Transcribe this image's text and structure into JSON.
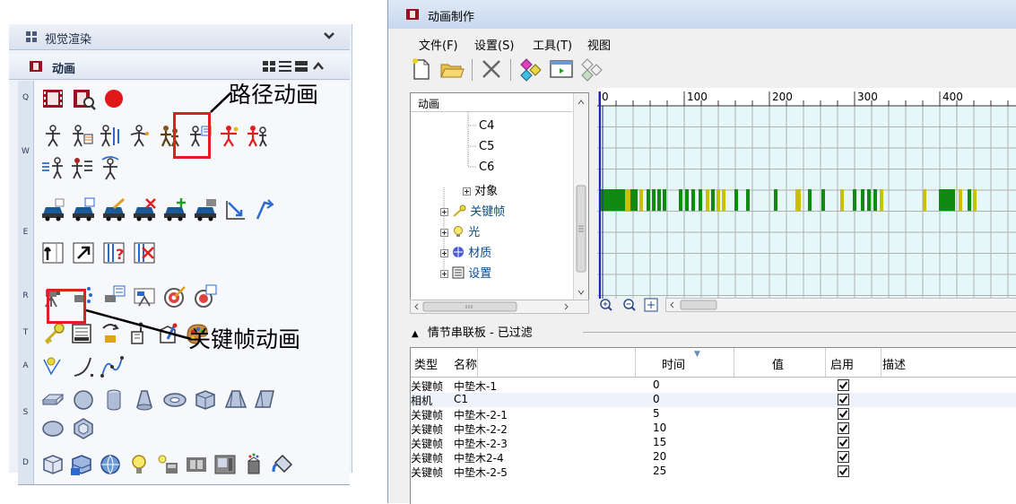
{
  "palette": {
    "section_title": "视觉渲染",
    "animation_title": "动画",
    "group_letters": [
      "Q",
      "W",
      "E",
      "R",
      "T",
      "A",
      "S",
      "D"
    ]
  },
  "callouts": {
    "path_animation": "路径动画",
    "keyframe_animation": "关键帧动画"
  },
  "window": {
    "title": "动画制作",
    "menu": [
      "文件(F)",
      "设置(S)",
      "工具(T)",
      "视图"
    ],
    "tree": {
      "header": "动画",
      "nodes": [
        "C4",
        "C5",
        "C6",
        "对象",
        "关键帧",
        "光",
        "材质",
        "设置"
      ]
    },
    "timeline": {
      "ticks": [
        "0",
        "100",
        "200",
        "300",
        "400"
      ]
    },
    "filter_label": "情节串联板 - 已过滤",
    "grid": {
      "columns": [
        "类型",
        "名称",
        "时间",
        "值",
        "启用",
        "描述"
      ],
      "rows": [
        {
          "type": "关键帧",
          "name": "中垫木-1",
          "time": "0",
          "enabled": true
        },
        {
          "type": "相机",
          "name": "C1",
          "time": "0",
          "enabled": true
        },
        {
          "type": "关键帧",
          "name": "中垫木-2-1",
          "time": "5",
          "enabled": true
        },
        {
          "type": "关键帧",
          "name": "中垫木-2-2",
          "time": "10",
          "enabled": true
        },
        {
          "type": "关键帧",
          "name": "中垫木-2-3",
          "time": "15",
          "enabled": true
        },
        {
          "type": "关键帧",
          "name": "中垫木2-4",
          "time": "20",
          "enabled": true
        },
        {
          "type": "关键帧",
          "name": "中垫木-2-5",
          "time": "25",
          "enabled": true
        }
      ]
    }
  },
  "colors": {
    "highlight": "#e02020",
    "key_green": "#118a11",
    "key_yellow": "#c8c000",
    "timeline_band": "#e6f7f7",
    "cursor": "#2020c0"
  }
}
